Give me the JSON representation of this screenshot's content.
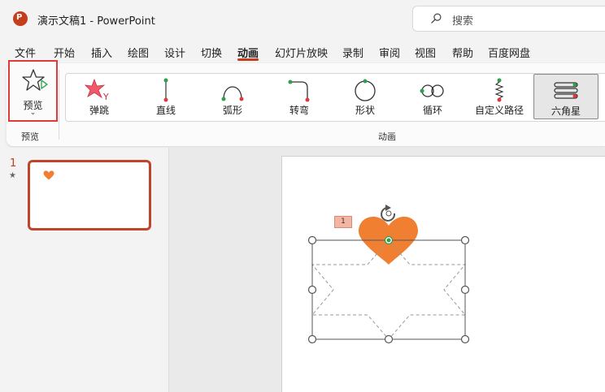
{
  "app": {
    "title": "演示文稿1  -  PowerPoint",
    "logo_letter": "P",
    "accent_color": "#c43e1c"
  },
  "search": {
    "placeholder": "搜索",
    "icon": "search-icon"
  },
  "menu": {
    "tabs": [
      "文件",
      "开始",
      "插入",
      "绘图",
      "设计",
      "切换",
      "动画",
      "幻灯片放映",
      "录制",
      "审阅",
      "视图",
      "帮助",
      "百度网盘"
    ],
    "active": "动画"
  },
  "ribbon": {
    "preview": {
      "label": "预览",
      "group_label": "预览",
      "icon": "preview-star-icon"
    },
    "animations": {
      "group_label": "动画",
      "items": [
        {
          "label": "弹跳",
          "icon": "bounce-icon"
        },
        {
          "label": "直线",
          "icon": "line-path-icon"
        },
        {
          "label": "弧形",
          "icon": "arc-path-icon"
        },
        {
          "label": "转弯",
          "icon": "turn-path-icon"
        },
        {
          "label": "形状",
          "icon": "shape-path-icon"
        },
        {
          "label": "循环",
          "icon": "loop-path-icon"
        },
        {
          "label": "自定义路径",
          "icon": "custom-path-icon"
        },
        {
          "label": "六角星",
          "icon": "hexagram-path-icon",
          "selected": true
        }
      ]
    }
  },
  "slides": {
    "items": [
      {
        "number": "1",
        "has_animation": "★"
      }
    ]
  },
  "canvas": {
    "animation_tag": "1",
    "shape_color": "#f07f32"
  }
}
